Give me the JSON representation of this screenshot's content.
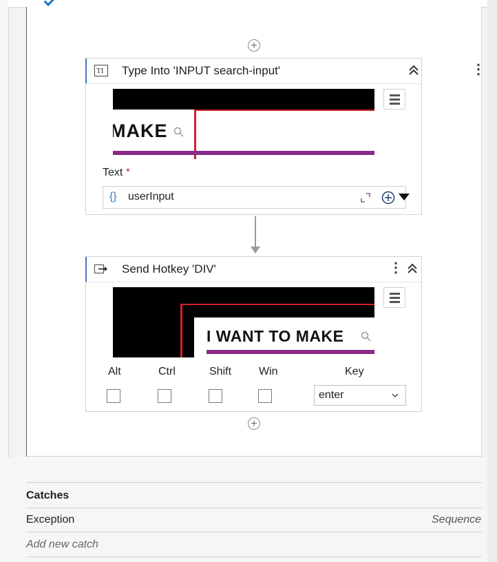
{
  "activities": [
    {
      "title": "Type Into 'INPUT  search-input'",
      "icon": "type-into-icon",
      "screenshot_text": "MAKE",
      "field_label": "Text",
      "required_marker": "*",
      "input_icon": "{}",
      "input_value": "userInput"
    },
    {
      "title": "Send Hotkey 'DIV'",
      "icon": "send-hotkey-icon",
      "screenshot_text": "I WANT TO MAKE",
      "modifiers": {
        "alt": "Alt",
        "ctrl": "Ctrl",
        "shift": "Shift",
        "win": "Win"
      },
      "key_label": "Key",
      "key_value": "enter"
    }
  ],
  "catches": {
    "header": "Catches",
    "exception_label": "Exception",
    "exception_type": "Sequence",
    "add_label": "Add new catch"
  },
  "colors": {
    "accent_blue": "#3b79c7",
    "selection_red": "#d0202a",
    "underline_purple": "#8a2a8a"
  }
}
